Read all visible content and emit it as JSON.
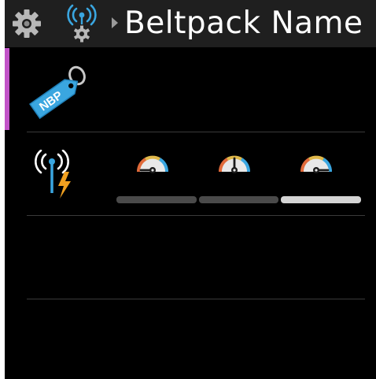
{
  "header": {
    "title": "Beltpack Name",
    "icons": [
      "gear-icon",
      "wireless-settings-icon",
      "breadcrumb-arrow-icon"
    ]
  },
  "name_row": {
    "tag_text": "NBP",
    "icon": "name-tag-icon"
  },
  "signal_row": {
    "icon": "signal-power-icon",
    "gauges": [
      {
        "icon": "gauge-low-icon",
        "level": "low"
      },
      {
        "icon": "gauge-medium-icon",
        "level": "medium"
      },
      {
        "icon": "gauge-high-icon",
        "level": "high"
      }
    ],
    "selected_level": "high"
  },
  "colors": {
    "background": "#000000",
    "header": "#1f1f1f",
    "accent": "#c254c8",
    "tag": "#3aa6e0",
    "segment_active": "#d4d4d4",
    "segment_inactive": "#4a4a4a"
  }
}
